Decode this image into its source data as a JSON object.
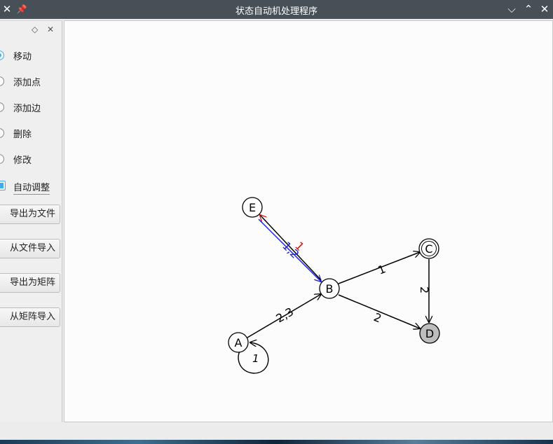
{
  "window": {
    "title": "状态自动机处理程序"
  },
  "dock": {
    "modes": [
      {
        "label": "移动",
        "selected": true
      },
      {
        "label": "添加点",
        "selected": false
      },
      {
        "label": "添加边",
        "selected": false
      },
      {
        "label": "删除",
        "selected": false
      },
      {
        "label": "修改",
        "selected": false
      }
    ],
    "auto_adjust": {
      "label": "自动调整",
      "checked": true
    },
    "buttons": [
      "导出为文件",
      "从文件导入",
      "导出为矩阵",
      "从矩阵导入"
    ]
  },
  "graph": {
    "nodes": [
      {
        "id": "A",
        "label": "A",
        "kind": "normal"
      },
      {
        "id": "B",
        "label": "B",
        "kind": "normal"
      },
      {
        "id": "C",
        "label": "C",
        "kind": "accepting"
      },
      {
        "id": "D",
        "label": "D",
        "kind": "current",
        "fill": "#bdbdbd"
      },
      {
        "id": "E",
        "label": "E",
        "kind": "normal"
      }
    ],
    "edges": [
      {
        "from": "A",
        "to": "B",
        "label": "2,3",
        "color": "#000000"
      },
      {
        "from": "B",
        "to": "C",
        "label": "1",
        "color": "#000000"
      },
      {
        "from": "B",
        "to": "D",
        "label": "2",
        "color": "#000000"
      },
      {
        "from": "C",
        "to": "D",
        "label": "2",
        "color": "#000000"
      },
      {
        "from": "E",
        "to": "B",
        "label": "1,2",
        "color": "#1f1fd6"
      },
      {
        "from": "B",
        "to": "E",
        "label": "1",
        "color": "#e01010"
      },
      {
        "from": "A",
        "to": "A",
        "label": "1",
        "color": "#000000"
      }
    ]
  }
}
